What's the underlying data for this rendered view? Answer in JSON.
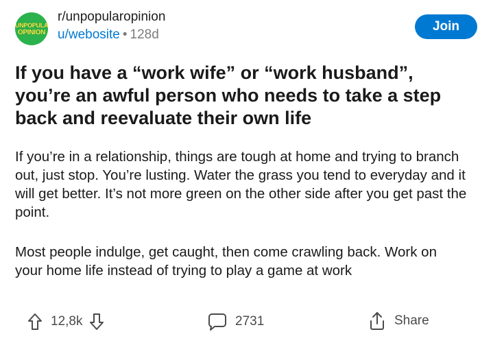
{
  "post": {
    "subreddit": "r/unpopularopinion",
    "icon_text_line1": "UNPOPULAR",
    "icon_text_line2": "OPINION",
    "author": "u/webosite",
    "separator": "•",
    "age": "128d",
    "join_label": "Join",
    "title": "If you have a “work wife” or “work husband”, you’re an awful person who needs to take a step back and reevaluate their own life",
    "paragraphs": [
      "If you’re in a relationship, things are tough at home and trying to branch out, just stop. You’re lusting. Water the grass you tend to everyday and it will get better. It’s not more green on the other side after you get past the point.",
      "Most people indulge, get caught, then come crawling back. Work on your home life instead of trying to play a game at work"
    ]
  },
  "actions": {
    "upvote_icon": "upvote-arrow-icon",
    "vote_count": "12,8k",
    "downvote_icon": "downvote-arrow-icon",
    "comment_icon": "comment-bubble-icon",
    "comment_count": "2731",
    "share_icon": "share-icon",
    "share_label": "Share"
  },
  "colors": {
    "accent_blue": "#0079d3",
    "subreddit_icon_green": "#2bb24c",
    "subreddit_icon_text": "#ffe94a",
    "muted_text": "#7c7c7c"
  }
}
